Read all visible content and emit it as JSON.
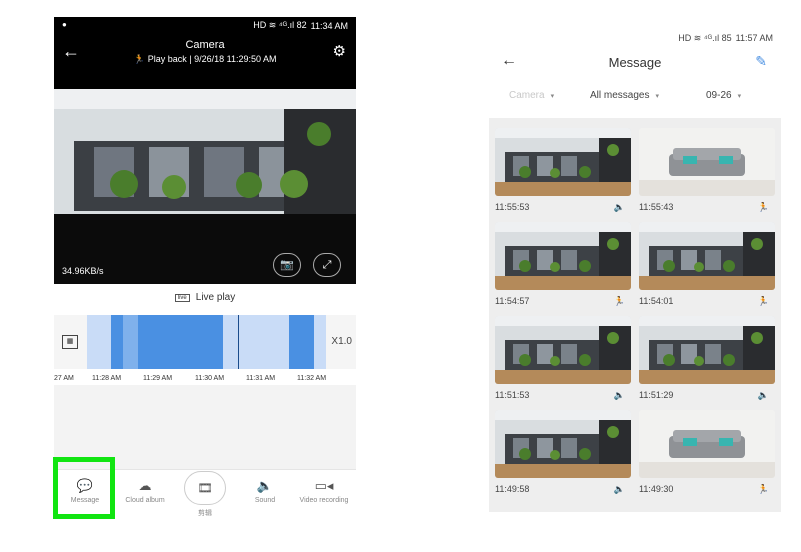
{
  "left": {
    "status_bar": {
      "time": "11:34 AM",
      "icons": "HD ≋ ⁴ᴳ.ıl 82"
    },
    "header": {
      "title": "Camera",
      "subtitle": "Play back | 9/26/18 11:29:50 AM",
      "back_icon": "back-arrow-icon",
      "settings_icon": "gear-icon"
    },
    "video": {
      "bitrate": "34.96KB/s"
    },
    "live_play_label": "Live play",
    "timeline": {
      "speed": "X1.0",
      "ticks": [
        "27 AM",
        "11:28 AM",
        "11:29 AM",
        "11:30 AM",
        "11:31 AM",
        "11:32 AM"
      ]
    },
    "toolbar": {
      "message": "Message",
      "cloud_album": "Cloud album",
      "clip": "剪辑",
      "sound": "Sound",
      "video_recording": "Video recording"
    },
    "highlight_color": "#11e511"
  },
  "right": {
    "status_bar": {
      "time": "11:57 AM",
      "icons": "HD ≋ ⁴ᴳ.ıl 85"
    },
    "header": {
      "title": "Message",
      "back_icon": "back-arrow-icon",
      "edit_icon": "edit-icon"
    },
    "filters": {
      "camera": "Camera",
      "type": "All messages",
      "date": "09-26"
    },
    "messages": [
      {
        "time": "11:55:53",
        "kind": "sound",
        "scene": "office"
      },
      {
        "time": "11:55:43",
        "kind": "motion",
        "scene": "sofa"
      },
      {
        "time": "11:54:57",
        "kind": "motion",
        "scene": "office"
      },
      {
        "time": "11:54:01",
        "kind": "motion",
        "scene": "office"
      },
      {
        "time": "11:51:53",
        "kind": "sound",
        "scene": "office"
      },
      {
        "time": "11:51:29",
        "kind": "sound",
        "scene": "office"
      },
      {
        "time": "11:49:58",
        "kind": "sound",
        "scene": "office"
      },
      {
        "time": "11:49:30",
        "kind": "motion",
        "scene": "sofa"
      }
    ],
    "accent_color": "#4a90e2",
    "motion_color": "#f5a623"
  }
}
